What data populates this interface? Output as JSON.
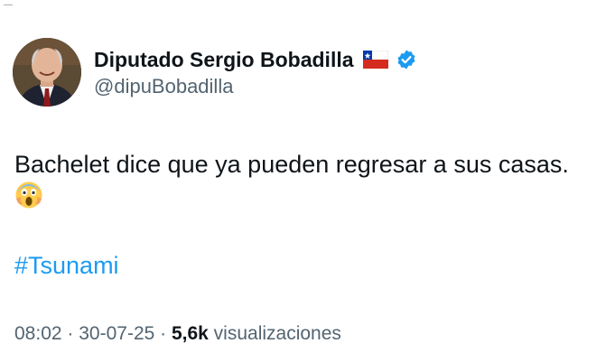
{
  "top_mark": "—",
  "author": {
    "display_name": "Diputado Sergio Bobadilla",
    "handle": "@dipuBobadilla",
    "flag_icon": "chile-flag-icon",
    "verified_icon": "verified-badge-icon",
    "verified_color": "#1d9bf0"
  },
  "tweet": {
    "text": "Bachelet dice que ya pueden regresar a sus casas.",
    "emoji_icon": "face-screaming-in-fear-icon",
    "hashtag": "#Tsunami",
    "hashtag_color": "#1d9bf0"
  },
  "meta": {
    "time": "08:02",
    "separator": " · ",
    "date": "30-07-25",
    "views_count": "5,6k",
    "views_label": " visualizaciones"
  }
}
